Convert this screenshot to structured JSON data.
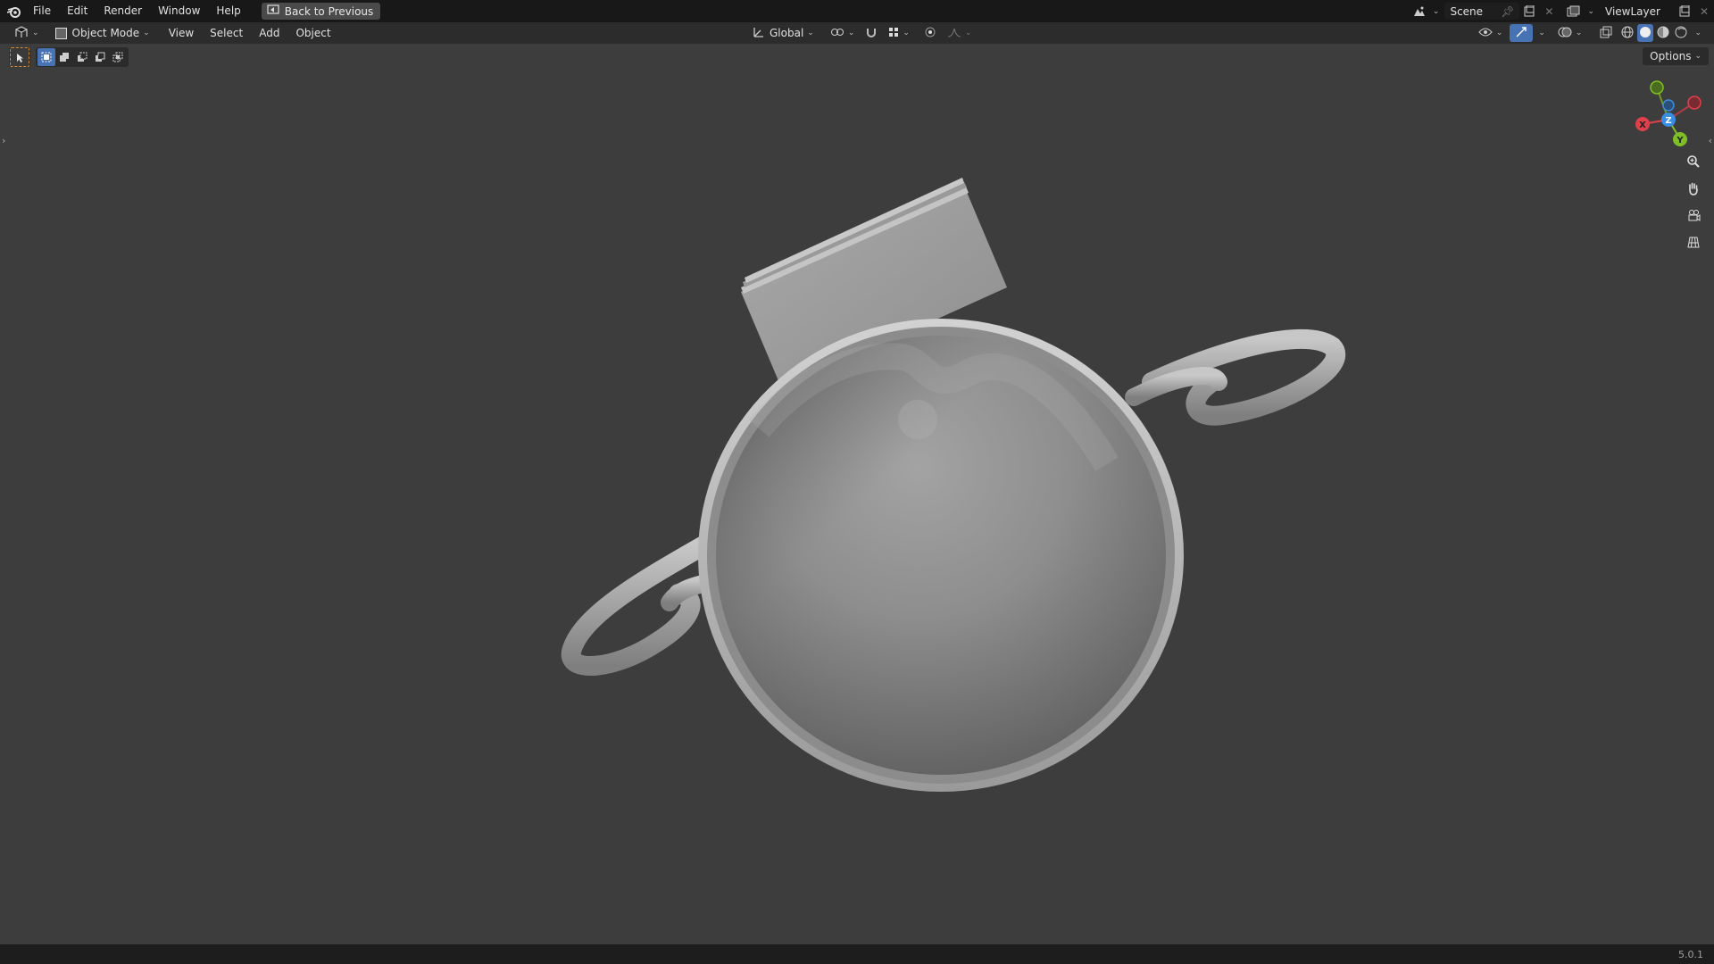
{
  "menubar": {
    "items": [
      "File",
      "Edit",
      "Render",
      "Window",
      "Help"
    ],
    "back_button": "Back to Previous"
  },
  "workspace": {
    "scene_name": "Scene",
    "view_layer": "ViewLayer"
  },
  "header": {
    "mode": "Object Mode",
    "menus": [
      "View",
      "Select",
      "Add",
      "Object"
    ],
    "transform_orientation": "Global"
  },
  "toolbar": {
    "options_label": "Options"
  },
  "gizmo": {
    "x_label": "X",
    "y_label": "Y",
    "z_label": "Z",
    "colors": {
      "x": "#e0404c",
      "y": "#7fbf26",
      "z": "#3a8de0"
    }
  },
  "status": {
    "version": "5.0.1"
  },
  "theme": {
    "accent": "#4772b3",
    "viewport_bg": "#3d3d3d"
  }
}
